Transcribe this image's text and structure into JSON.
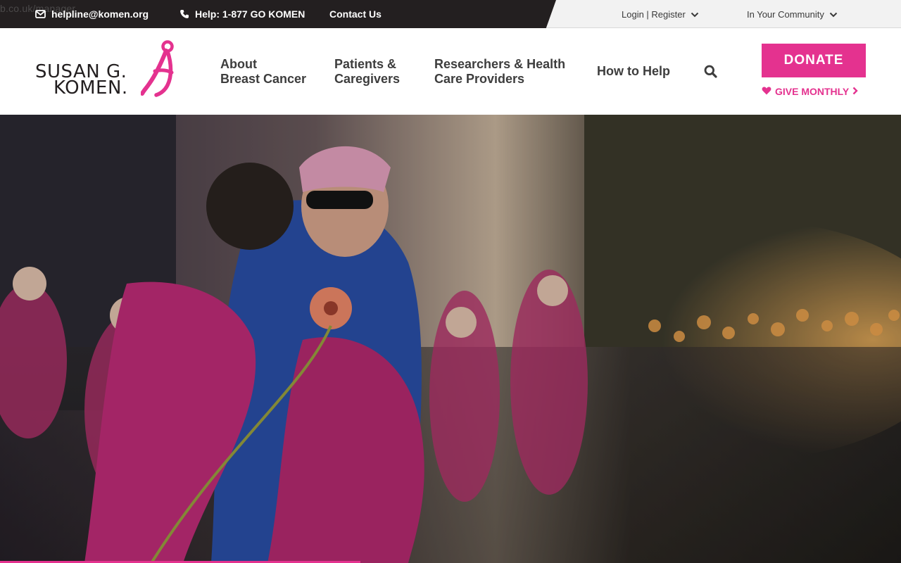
{
  "browser_artifact": "b.co.uk/manager",
  "utility_bar": {
    "email": "helpline@komen.org",
    "phone": "Help: 1-877 GO KOMEN",
    "contact": "Contact Us",
    "login": "Login | Register",
    "community": "In Your Community"
  },
  "brand": {
    "logo_line1": "SUSAN G.",
    "logo_line2": "KOMEN."
  },
  "nav": {
    "about": "About\nBreast Cancer",
    "patients": "Patients &\nCaregivers",
    "researchers": "Researchers & Health\nCare Providers",
    "how_to_help": "How to Help"
  },
  "actions": {
    "donate": "DONATE",
    "give_monthly": "GIVE MONTHLY"
  },
  "hero": {
    "image": "event-participants-embracing-photo",
    "carousel_progress": 0.4
  },
  "colors": {
    "brand_pink": "#e4328f",
    "dark_bar": "#231f20"
  }
}
